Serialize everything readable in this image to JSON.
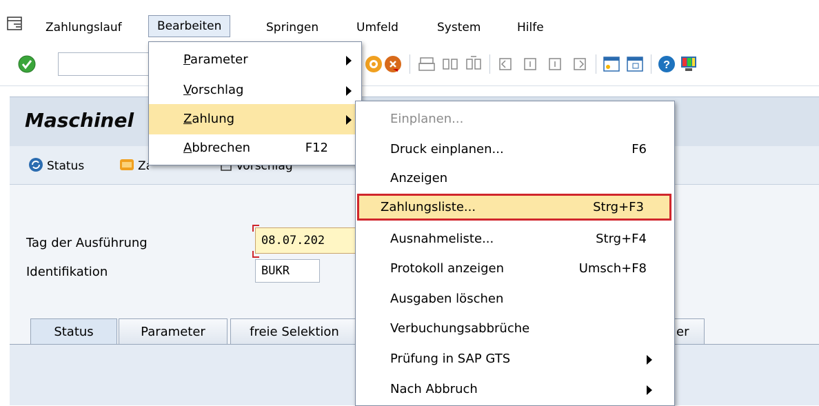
{
  "menubar": {
    "items": [
      {
        "label": "Zahlungslauf"
      },
      {
        "label": "Bearbeiten"
      },
      {
        "label": "Springen"
      },
      {
        "label": "Umfeld"
      },
      {
        "label": "System"
      },
      {
        "label": "Hilfe"
      }
    ]
  },
  "toolbar": {
    "command_field": {
      "value": "",
      "placeholder": ""
    }
  },
  "page": {
    "title": "Maschinel",
    "app_toolbar": {
      "status": "Status",
      "zahlung": "Zahlung",
      "vorschlag": "Vorschlag"
    }
  },
  "form": {
    "tag_label": "Tag der Ausführung",
    "tag_value": "08.07.202",
    "id_label": "Identifikation",
    "id_value": "BUKR"
  },
  "tabs": [
    "Status",
    "Parameter",
    "freie Selektion",
    "er"
  ],
  "edit_menu": {
    "items": [
      {
        "label": "Parameter",
        "has_submenu": true
      },
      {
        "label": "Vorschlag",
        "has_submenu": true
      },
      {
        "label": "Zahlung",
        "has_submenu": true,
        "highlighted": true
      },
      {
        "label": "Abbrechen",
        "shortcut": "F12"
      }
    ]
  },
  "payment_submenu": {
    "items": [
      {
        "label": "Einplanen...",
        "disabled": true
      },
      {
        "label": "Druck einplanen...",
        "shortcut": "F6"
      },
      {
        "label": "Anzeigen"
      },
      {
        "label": "Zahlungsliste...",
        "shortcut": "Strg+F3",
        "selected": true
      },
      {
        "label": "Ausnahmeliste...",
        "shortcut": "Strg+F4"
      },
      {
        "label": "Protokoll anzeigen",
        "shortcut": "Umsch+F8"
      },
      {
        "label": "Ausgaben löschen"
      },
      {
        "label": "Verbuchungsabbrüche"
      },
      {
        "label": "Prüfung in SAP GTS",
        "has_submenu": true
      },
      {
        "label": "Nach Abbruch",
        "has_submenu": true
      }
    ]
  },
  "colors": {
    "highlight": "#fce7a5",
    "selection_border": "#d0262c",
    "title_band": "#d9e2ed"
  }
}
